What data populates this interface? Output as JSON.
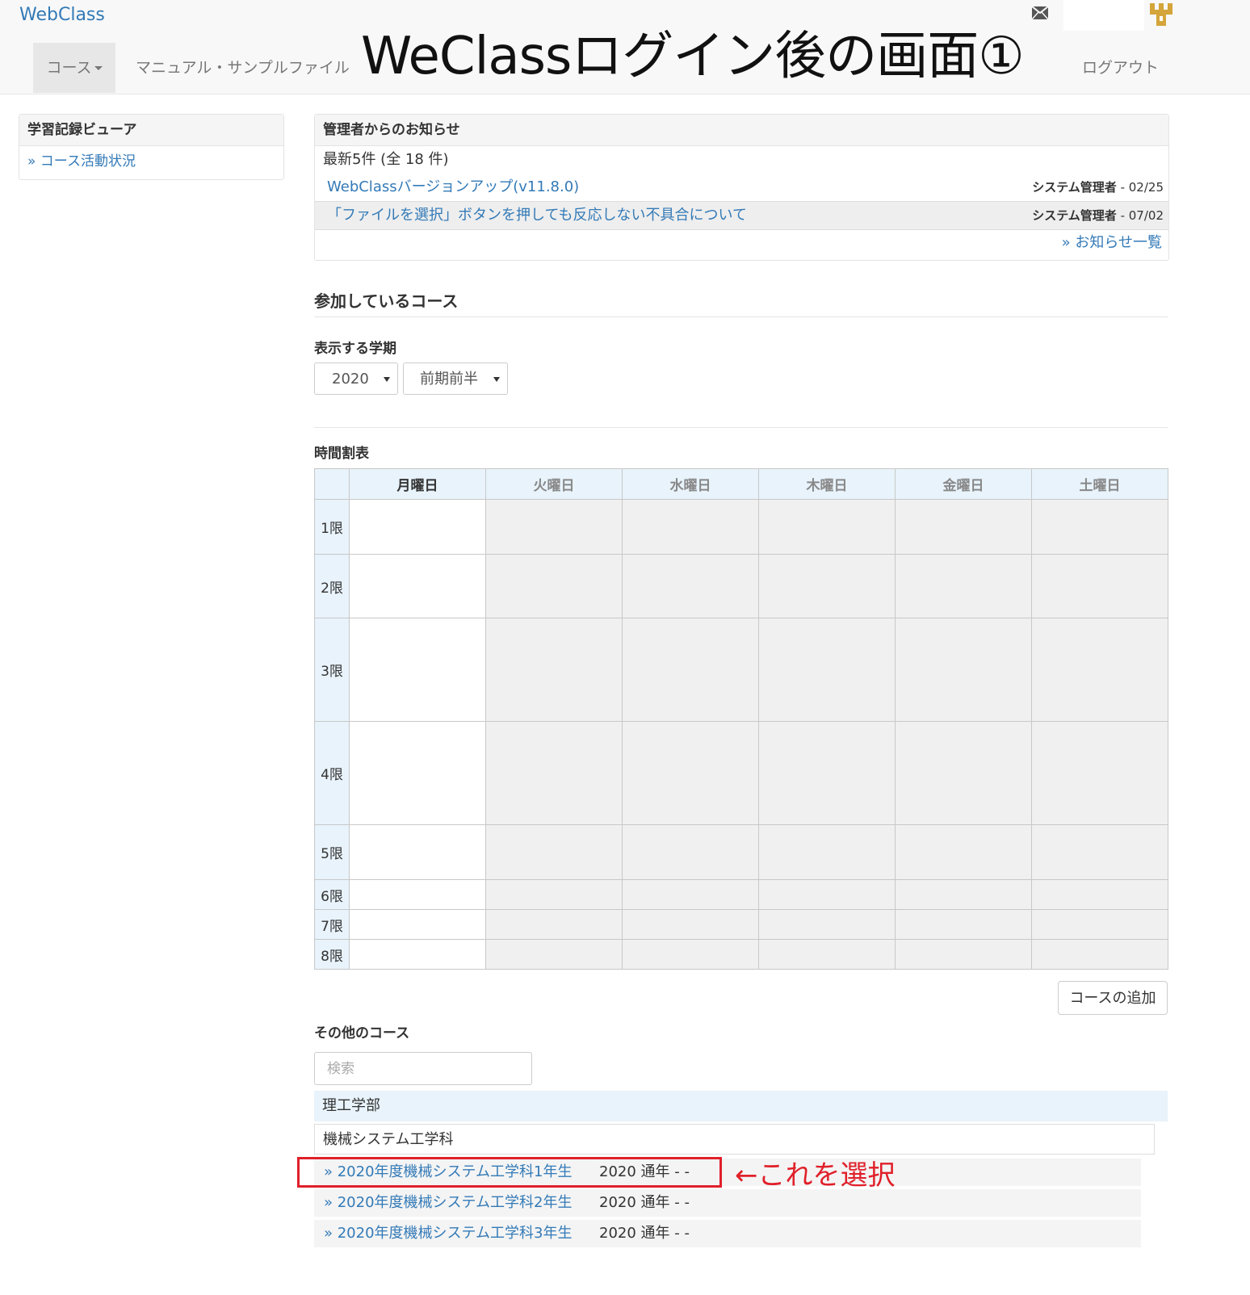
{
  "navbar": {
    "brand": "WebClass",
    "course_menu": "コース",
    "manual_link": "マニュアル・サンプルファイル",
    "page_title": "WeClassログイン後の画面①",
    "logout": "ログアウト"
  },
  "left_panel": {
    "title": "学習記録ビューア",
    "link": "» コース活動状況"
  },
  "notice": {
    "title": "管理者からのお知らせ",
    "subtitle": "最新5件 (全 18 件)",
    "items": [
      {
        "title": "WebClassバージョンアップ(v11.8.0)",
        "author": "システム管理者",
        "date": " - 02/25"
      },
      {
        "title": "「ファイルを選択」ボタンを押しても反応しない不具合について",
        "author": "システム管理者",
        "date": " - 07/02"
      }
    ],
    "all_link": "» お知らせ一覧"
  },
  "courses": {
    "heading": "参加しているコース",
    "term_label": "表示する学期",
    "year_value": "2020",
    "term_value": "前期前半"
  },
  "timetable": {
    "heading": "時間割表",
    "days": [
      "月曜日",
      "火曜日",
      "水曜日",
      "木曜日",
      "金曜日",
      "土曜日"
    ],
    "periods": [
      "1限",
      "2限",
      "3限",
      "4限",
      "5限",
      "6限",
      "7限",
      "8限"
    ]
  },
  "add_course_label": "コースの追加",
  "other_courses": {
    "heading": "その他のコース",
    "search_placeholder": "検索",
    "faculty": "理工学部",
    "department": "機械システム工学科",
    "items": [
      {
        "name": "» 2020年度機械システム工学科1年生",
        "term": "2020 通年 - -"
      },
      {
        "name": "» 2020年度機械システム工学科2年生",
        "term": "2020 通年 - -"
      },
      {
        "name": "» 2020年度機械システム工学科3年生",
        "term": "2020 通年 - -"
      }
    ]
  },
  "annotation": "←これを選択",
  "colors": {
    "link": "#337ab7",
    "highlight": "#e0202a",
    "header_bg": "#e8f3fb"
  }
}
